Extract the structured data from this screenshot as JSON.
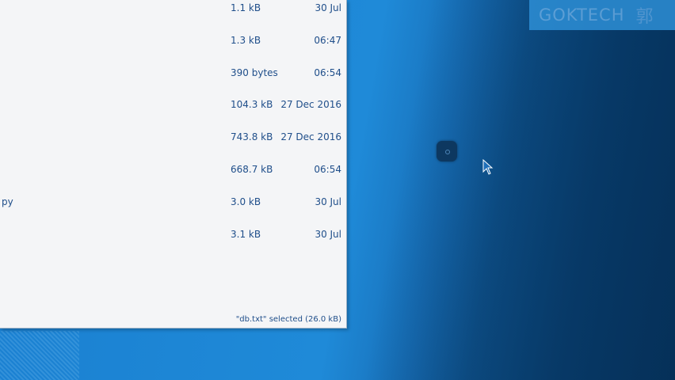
{
  "files": [
    {
      "name": "",
      "size": "1.1 kB",
      "date": "30 Jul"
    },
    {
      "name": "",
      "size": "1.3 kB",
      "date": "06:47"
    },
    {
      "name": "",
      "size": "390 bytes",
      "date": "06:54"
    },
    {
      "name": "",
      "size": "104.3 kB",
      "date": "27 Dec 2016"
    },
    {
      "name": "",
      "size": "743.8 kB",
      "date": "27 Dec 2016"
    },
    {
      "name": "",
      "size": "668.7 kB",
      "date": "06:54"
    },
    {
      "name": "py",
      "size": "3.0 kB",
      "date": "30 Jul"
    },
    {
      "name": "",
      "size": "3.1 kB",
      "date": "30 Jul"
    }
  ],
  "status": {
    "selection": "\"db.txt\" selected  (26.0 kB)"
  },
  "watermark": {
    "text": "GOKTECH",
    "char": "郭"
  },
  "colors": {
    "desktop": "#1f8ad8",
    "text": "#1f4e8a",
    "window": "#f4f5f7"
  }
}
